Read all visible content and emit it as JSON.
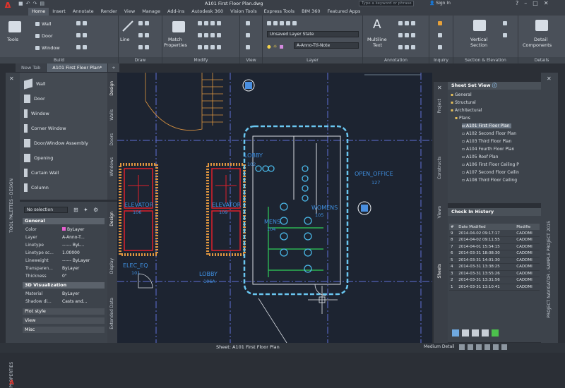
{
  "app": {
    "logo": "A",
    "title": "A101 First Floor Plan.dwg",
    "search_placeholder": "Type a keyword or phrase",
    "signin": "Sign In"
  },
  "qat": [
    "save-icon",
    "undo-icon",
    "redo-icon",
    "print-icon"
  ],
  "ribbon_tabs": [
    "Home",
    "Insert",
    "Annotate",
    "Render",
    "View",
    "Manage",
    "Add-ins",
    "Autodesk 360",
    "Vision Tools",
    "Express Tools",
    "BIM 360",
    "Featured Apps"
  ],
  "ribbon": {
    "build": {
      "title": "Build",
      "tools": "Tools",
      "wall": "Wall",
      "door": "Door",
      "window": "Window"
    },
    "draw": {
      "title": "Draw",
      "line": "Line"
    },
    "modify": {
      "title": "Modify",
      "match": "Match",
      "properties": "Properties"
    },
    "view": {
      "title": "View"
    },
    "layer": {
      "title": "Layer",
      "state": "Unsaved Layer State",
      "current": "A-Anno-Ttl-Note"
    },
    "annotation": {
      "title": "Annotation",
      "multiline": "Multiline",
      "text": "Text",
      "letter": "A"
    },
    "inquiry": {
      "title": "Inquiry"
    },
    "section": {
      "title": "Section & Elevation",
      "vertical": "Vertical",
      "section_lbl": "Section"
    },
    "details": {
      "title": "Details",
      "detail": "Detail",
      "components": "Components"
    }
  },
  "file_tabs": [
    "New Tab",
    "A101 First Floor Plan*",
    "+"
  ],
  "tool_palette": {
    "items": [
      "Wall",
      "Door",
      "Window",
      "Corner Window",
      "Door/Window Assembly",
      "Opening",
      "Curtain Wall",
      "Column"
    ],
    "side_label": "TOOL PALETTES - DESIGN",
    "tabs": [
      "Design",
      "Walls",
      "Doors",
      "Windows"
    ]
  },
  "properties": {
    "selection": "No selection",
    "side_label": "PROPERTIES",
    "tabs": [
      "Design",
      "Display",
      "Extended Data"
    ],
    "general_title": "General",
    "general": [
      {
        "k": "Color",
        "v": "ByLayer"
      },
      {
        "k": "Layer",
        "v": "A-Anno-T..."
      },
      {
        "k": "Linetype",
        "v": "------ ByL..."
      },
      {
        "k": "Linetype sc...",
        "v": "1.00000"
      },
      {
        "k": "Lineweight",
        "v": "------ ByLayer"
      },
      {
        "k": "Transparen...",
        "v": "ByLayer"
      },
      {
        "k": "Thickness",
        "v": "0\""
      }
    ],
    "vis_title": "3D Visualization",
    "vis": [
      {
        "k": "Material",
        "v": "ByLayer"
      },
      {
        "k": "Shadow di...",
        "v": "Casts and..."
      }
    ],
    "more": [
      "Plot style",
      "View",
      "Misc"
    ]
  },
  "drawing": {
    "labels": [
      "LOBBY",
      "OPEN_OFFICE",
      "MENS",
      "WOMENS",
      "ELEVATOR",
      "ELEVATOR",
      "ELEC_EQ",
      "LOBBY"
    ],
    "tags": [
      "102",
      "127",
      "104",
      "105",
      "106",
      "109",
      "101",
      "106A"
    ]
  },
  "sheet_set": {
    "title": "Sheet Set View",
    "tree": [
      {
        "t": "General",
        "lvl": 1
      },
      {
        "t": "Structural",
        "lvl": 1
      },
      {
        "t": "Architectural",
        "lvl": 1
      },
      {
        "t": "Plans",
        "lvl": 2
      },
      {
        "t": "A101 First Floor Plan",
        "lvl": 3,
        "sel": true
      },
      {
        "t": "A102 Second Floor Plan",
        "lvl": 3
      },
      {
        "t": "A103 Third Floor Plan",
        "lvl": 3
      },
      {
        "t": "A104 Fourth Floor Plan",
        "lvl": 3
      },
      {
        "t": "A105 Roof Plan",
        "lvl": 3
      },
      {
        "t": "A106 First Floor Ceiling P",
        "lvl": 3
      },
      {
        "t": "A107 Second Floor Ceilin",
        "lvl": 3
      },
      {
        "t": "A108 Third Floor Ceiling",
        "lvl": 3
      }
    ],
    "side_tabs": [
      "Project",
      "Constructs",
      "Views",
      "Sheets"
    ],
    "right_label": "PROJECT NAVIGATOR - SAMPLE PROJECT 2015"
  },
  "checkin": {
    "title": "Check In History",
    "headers": [
      "#",
      "Date Modified",
      "Modifie"
    ],
    "rows": [
      [
        "9",
        "2014-04-02 09:17:17",
        "CADDMI"
      ],
      [
        "8",
        "2014-04-02 09:11:55",
        "CADDMI"
      ],
      [
        "7",
        "2014-04-01 15:54:15",
        "CADDMI"
      ],
      [
        "6",
        "2014-03-31 18:08:30",
        "CADDMI"
      ],
      [
        "5",
        "2014-03-31 14:01:30",
        "CADDMI"
      ],
      [
        "4",
        "2014-03-31 13:38:25",
        "CADDMI"
      ],
      [
        "3",
        "2014-03-31 13:55:26",
        "CADDMI"
      ],
      [
        "2",
        "2014-03-31 13:31:56",
        "CADDMI"
      ],
      [
        "1",
        "2014-03-31 13:10:41",
        "CADDMI"
      ]
    ]
  },
  "status": {
    "sheet": "Sheet: A101 First Floor Plan",
    "medium": "Medium Detail"
  }
}
